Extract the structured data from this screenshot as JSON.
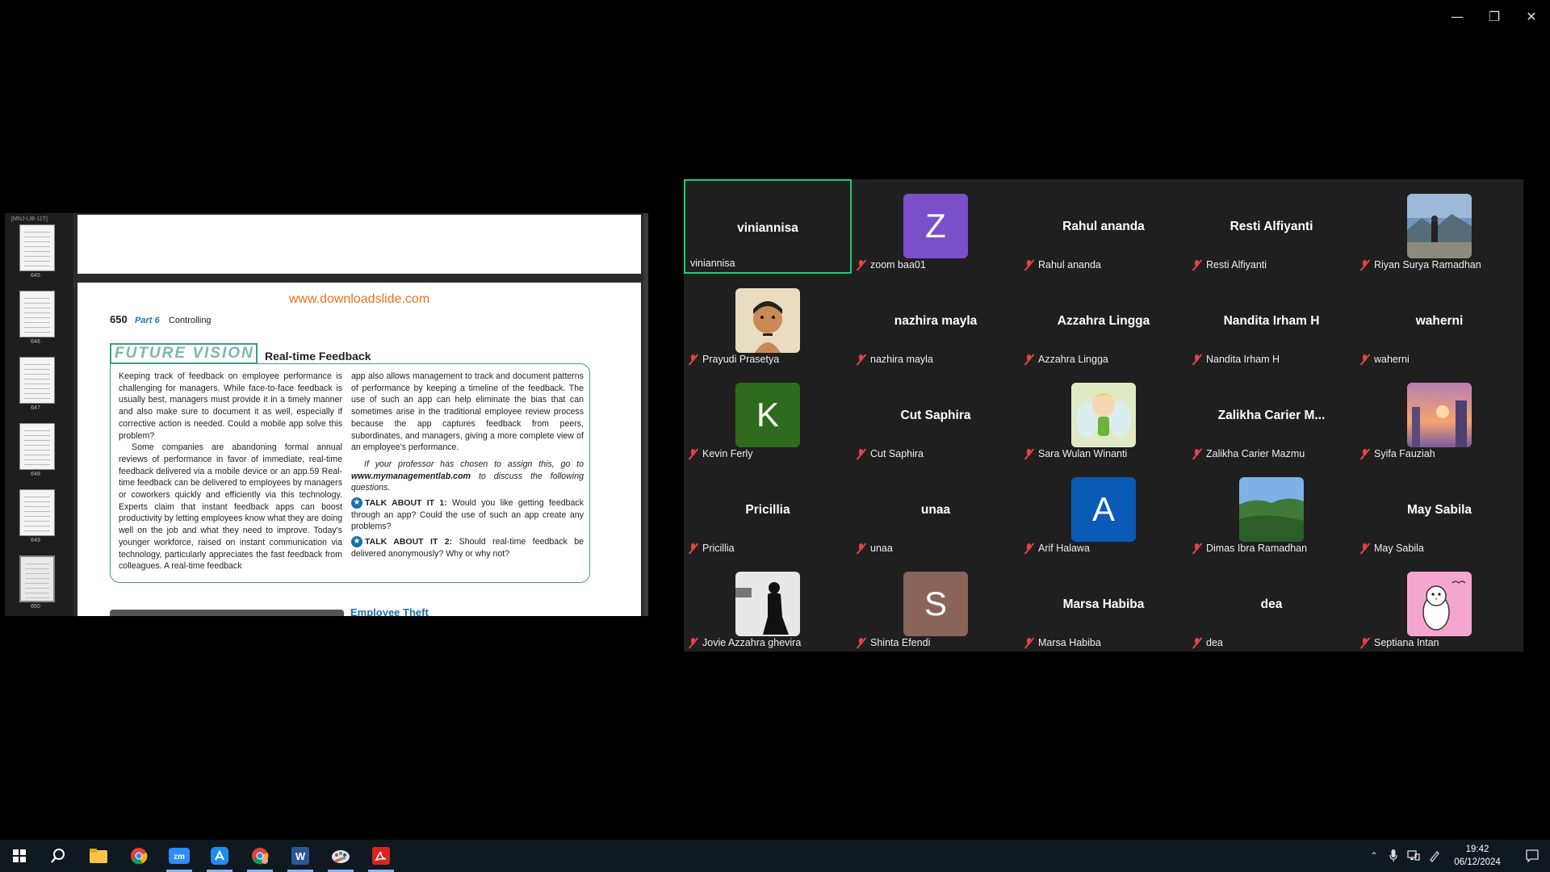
{
  "window": {
    "minimize": "—",
    "restore": "❐",
    "close": "✕"
  },
  "shared_screen": {
    "thumb_header": "[MNJ-LIB-11T]",
    "thumbnails": [
      {
        "page": "645"
      },
      {
        "page": "646"
      },
      {
        "page": "647"
      },
      {
        "page": "648"
      },
      {
        "page": "649"
      },
      {
        "page": "650"
      }
    ],
    "page": {
      "site": "www.downloadslide.com",
      "number": "650",
      "part": "Part 6",
      "section": "Controlling",
      "box_label": "FUTURE VISION",
      "box_title": "Real-time Feedback",
      "col1_p1": "Keeping track of feedback on employee performance is challenging for managers. While face-to-face feedback is usually best, managers must provide it in a timely manner and also make sure to document it as well, especially if corrective action is needed. Could a mobile app solve this problem?",
      "col1_p2": "Some companies are abandoning formal annual reviews of performance in favor of immediate, real-time feedback delivered via a mobile device or an app.59 Real-time feedback can be delivered to employees by managers or coworkers quickly and efficiently via this technology. Experts claim that instant feedback apps can boost productivity by letting employees know what they are doing well on the job and what they need to improve. Today's younger workforce, raised on instant communication via technology, particularly appreciates the fast feedback from colleagues. A real-time feedback",
      "col2_p1": "app also allows management to track and document patterns of performance by keeping a timeline of the feedback. The use of such an app can help eliminate the bias that can sometimes arise in the traditional employee review process because the app captures feedback from peers, subordinates, and managers, giving a more complete view of an employee's performance.",
      "col2_assign_pre": "If your professor has chosen to assign this, go to ",
      "col2_assign_link": "www.mymanagementlab.com",
      "col2_assign_post": " to discuss the following questions.",
      "talk1_label": "TALK ABOUT IT 1:",
      "talk1_text": " Would you like getting feedback through an app? Could the use of such an app create any problems?",
      "talk2_label": "TALK ABOUT IT 2:",
      "talk2_text": " Should real-time feedback be delivered anonymously? Why or why not?",
      "next_heading": "Employee Theft"
    }
  },
  "participants": [
    {
      "name": "viniannisa",
      "center": "viniannisa",
      "active": true,
      "muted": false
    },
    {
      "name": "zoom baa01",
      "avatar_letter": "Z",
      "avatar_color": "#7b4fc9",
      "muted": true
    },
    {
      "name": "Rahul ananda",
      "center": "Rahul ananda",
      "muted": true
    },
    {
      "name": "Resti Alfiyanti",
      "center": "Resti Alfiyanti",
      "muted": true
    },
    {
      "name": "Riyan Surya Ramadhan",
      "avatar_image": "photo-mountains",
      "muted": true
    },
    {
      "name": "Prayudi Prasetya",
      "avatar_image": "portrait-drawing",
      "muted": true
    },
    {
      "name": "nazhira mayla",
      "center": "nazhira mayla",
      "muted": true
    },
    {
      "name": "Azzahra Lingga",
      "center": "Azzahra Lingga",
      "muted": true
    },
    {
      "name": "Nandita Irham H",
      "center": "Nandita Irham H",
      "muted": true
    },
    {
      "name": "waherni",
      "center": "waherni",
      "muted": true
    },
    {
      "name": "Kevin Ferly",
      "avatar_letter": "K",
      "avatar_color": "#2f6b1c",
      "muted": true
    },
    {
      "name": "Cut Saphira",
      "center": "Cut Saphira",
      "muted": true
    },
    {
      "name": "Sara Wulan Winanti",
      "avatar_image": "fairy-cartoon",
      "muted": true
    },
    {
      "name": "Zalikha Carier Mazmu",
      "center": "Zalikha Carier M...",
      "muted": true
    },
    {
      "name": "Syifa Fauziah",
      "avatar_image": "sunset-town",
      "muted": true
    },
    {
      "name": "Pricillia",
      "center": "Pricillia",
      "muted": true
    },
    {
      "name": "unaa",
      "center": "unaa",
      "muted": true
    },
    {
      "name": "Arif Halawa",
      "avatar_letter": "A",
      "avatar_color": "#0a5bb5",
      "muted": true
    },
    {
      "name": "Dimas Ibra Ramadhan",
      "avatar_image": "forest-landscape",
      "muted": true
    },
    {
      "name": "May Sabila",
      "center": "May Sabila",
      "muted": true
    },
    {
      "name": "Jovie Azzahra ghevira",
      "avatar_image": "silhouette-bw",
      "muted": true
    },
    {
      "name": "Shinta Efendi",
      "avatar_letter": "S",
      "avatar_color": "#8a6458",
      "muted": true
    },
    {
      "name": "Marsa Habiba",
      "center": "Marsa Habiba",
      "muted": true
    },
    {
      "name": "dea",
      "center": "dea",
      "muted": true
    },
    {
      "name": "Septiana Intan",
      "avatar_image": "penguin-cartoon",
      "muted": true
    }
  ],
  "taskbar": {
    "apps": [
      "start-icon",
      "search-icon",
      "file-explorer-icon",
      "chrome-icon",
      "zoom-icon",
      "app-store-icon",
      "chrome-profile-icon",
      "word-icon",
      "paint-icon",
      "acrobat-icon"
    ],
    "time": "19:42",
    "date": "06/12/2024"
  }
}
